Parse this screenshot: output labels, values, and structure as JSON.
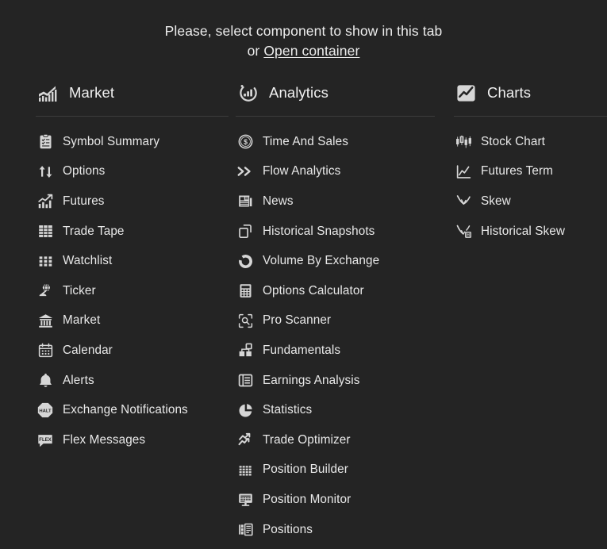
{
  "prompt": {
    "line1": "Please, select component to show in this tab",
    "line2_prefix": "or ",
    "link_label": "Open container"
  },
  "colors": {
    "background": "#242424",
    "text": "#e9e9e9",
    "icon": "#d6d6d6",
    "divider": "#3c3c3c"
  },
  "columns": [
    {
      "title": "Market",
      "icon": "market-growth-chart-icon",
      "items": [
        {
          "label": "Symbol Summary",
          "icon": "clipboard-list-icon"
        },
        {
          "label": "Options",
          "icon": "up-down-arrows-icon"
        },
        {
          "label": "Futures",
          "icon": "bar-chart-trend-icon"
        },
        {
          "label": "Trade Tape",
          "icon": "table-grid-icon"
        },
        {
          "label": "Watchlist",
          "icon": "dot-grid-icon"
        },
        {
          "label": "Ticker",
          "icon": "globe-stand-icon"
        },
        {
          "label": "Market",
          "icon": "bank-building-icon"
        },
        {
          "label": "Calendar",
          "icon": "calendar-icon"
        },
        {
          "label": "Alerts",
          "icon": "bell-icon"
        },
        {
          "label": "Exchange Notifications",
          "icon": "halt-octagon-icon",
          "badge": "HALT"
        },
        {
          "label": "Flex Messages",
          "icon": "flex-message-bubble-icon",
          "badge": "FLEX"
        }
      ]
    },
    {
      "title": "Analytics",
      "icon": "analytics-circle-bars-icon",
      "items": [
        {
          "label": "Time And Sales",
          "icon": "dollar-circle-icon"
        },
        {
          "label": "Flow Analytics",
          "icon": "double-chevron-right-icon"
        },
        {
          "label": "News",
          "icon": "newspaper-icon"
        },
        {
          "label": "Historical Snapshots",
          "icon": "layers-copy-icon"
        },
        {
          "label": "Volume By Exchange",
          "icon": "donut-chart-icon"
        },
        {
          "label": "Options Calculator",
          "icon": "calculator-icon"
        },
        {
          "label": "Pro Scanner",
          "icon": "scan-search-icon"
        },
        {
          "label": "Fundamentals",
          "icon": "blocks-hierarchy-icon"
        },
        {
          "label": "Earnings Analysis",
          "icon": "list-panel-icon"
        },
        {
          "label": "Statistics",
          "icon": "pie-chart-icon"
        },
        {
          "label": "Trade Optimizer",
          "icon": "trend-up-arrow-icon"
        },
        {
          "label": "Position Builder",
          "icon": "dense-grid-icon"
        },
        {
          "label": "Position Monitor",
          "icon": "monitor-screen-icon"
        },
        {
          "label": "Positions",
          "icon": "positions-panel-icon"
        }
      ]
    },
    {
      "title": "Charts",
      "icon": "charts-zigzag-tile-icon",
      "items": [
        {
          "label": "Stock Chart",
          "icon": "candlestick-icon"
        },
        {
          "label": "Futures Term",
          "icon": "line-chart-axis-icon"
        },
        {
          "label": "Skew",
          "icon": "skew-curve-icon"
        },
        {
          "label": "Historical Skew",
          "icon": "historical-skew-icon"
        }
      ]
    }
  ]
}
